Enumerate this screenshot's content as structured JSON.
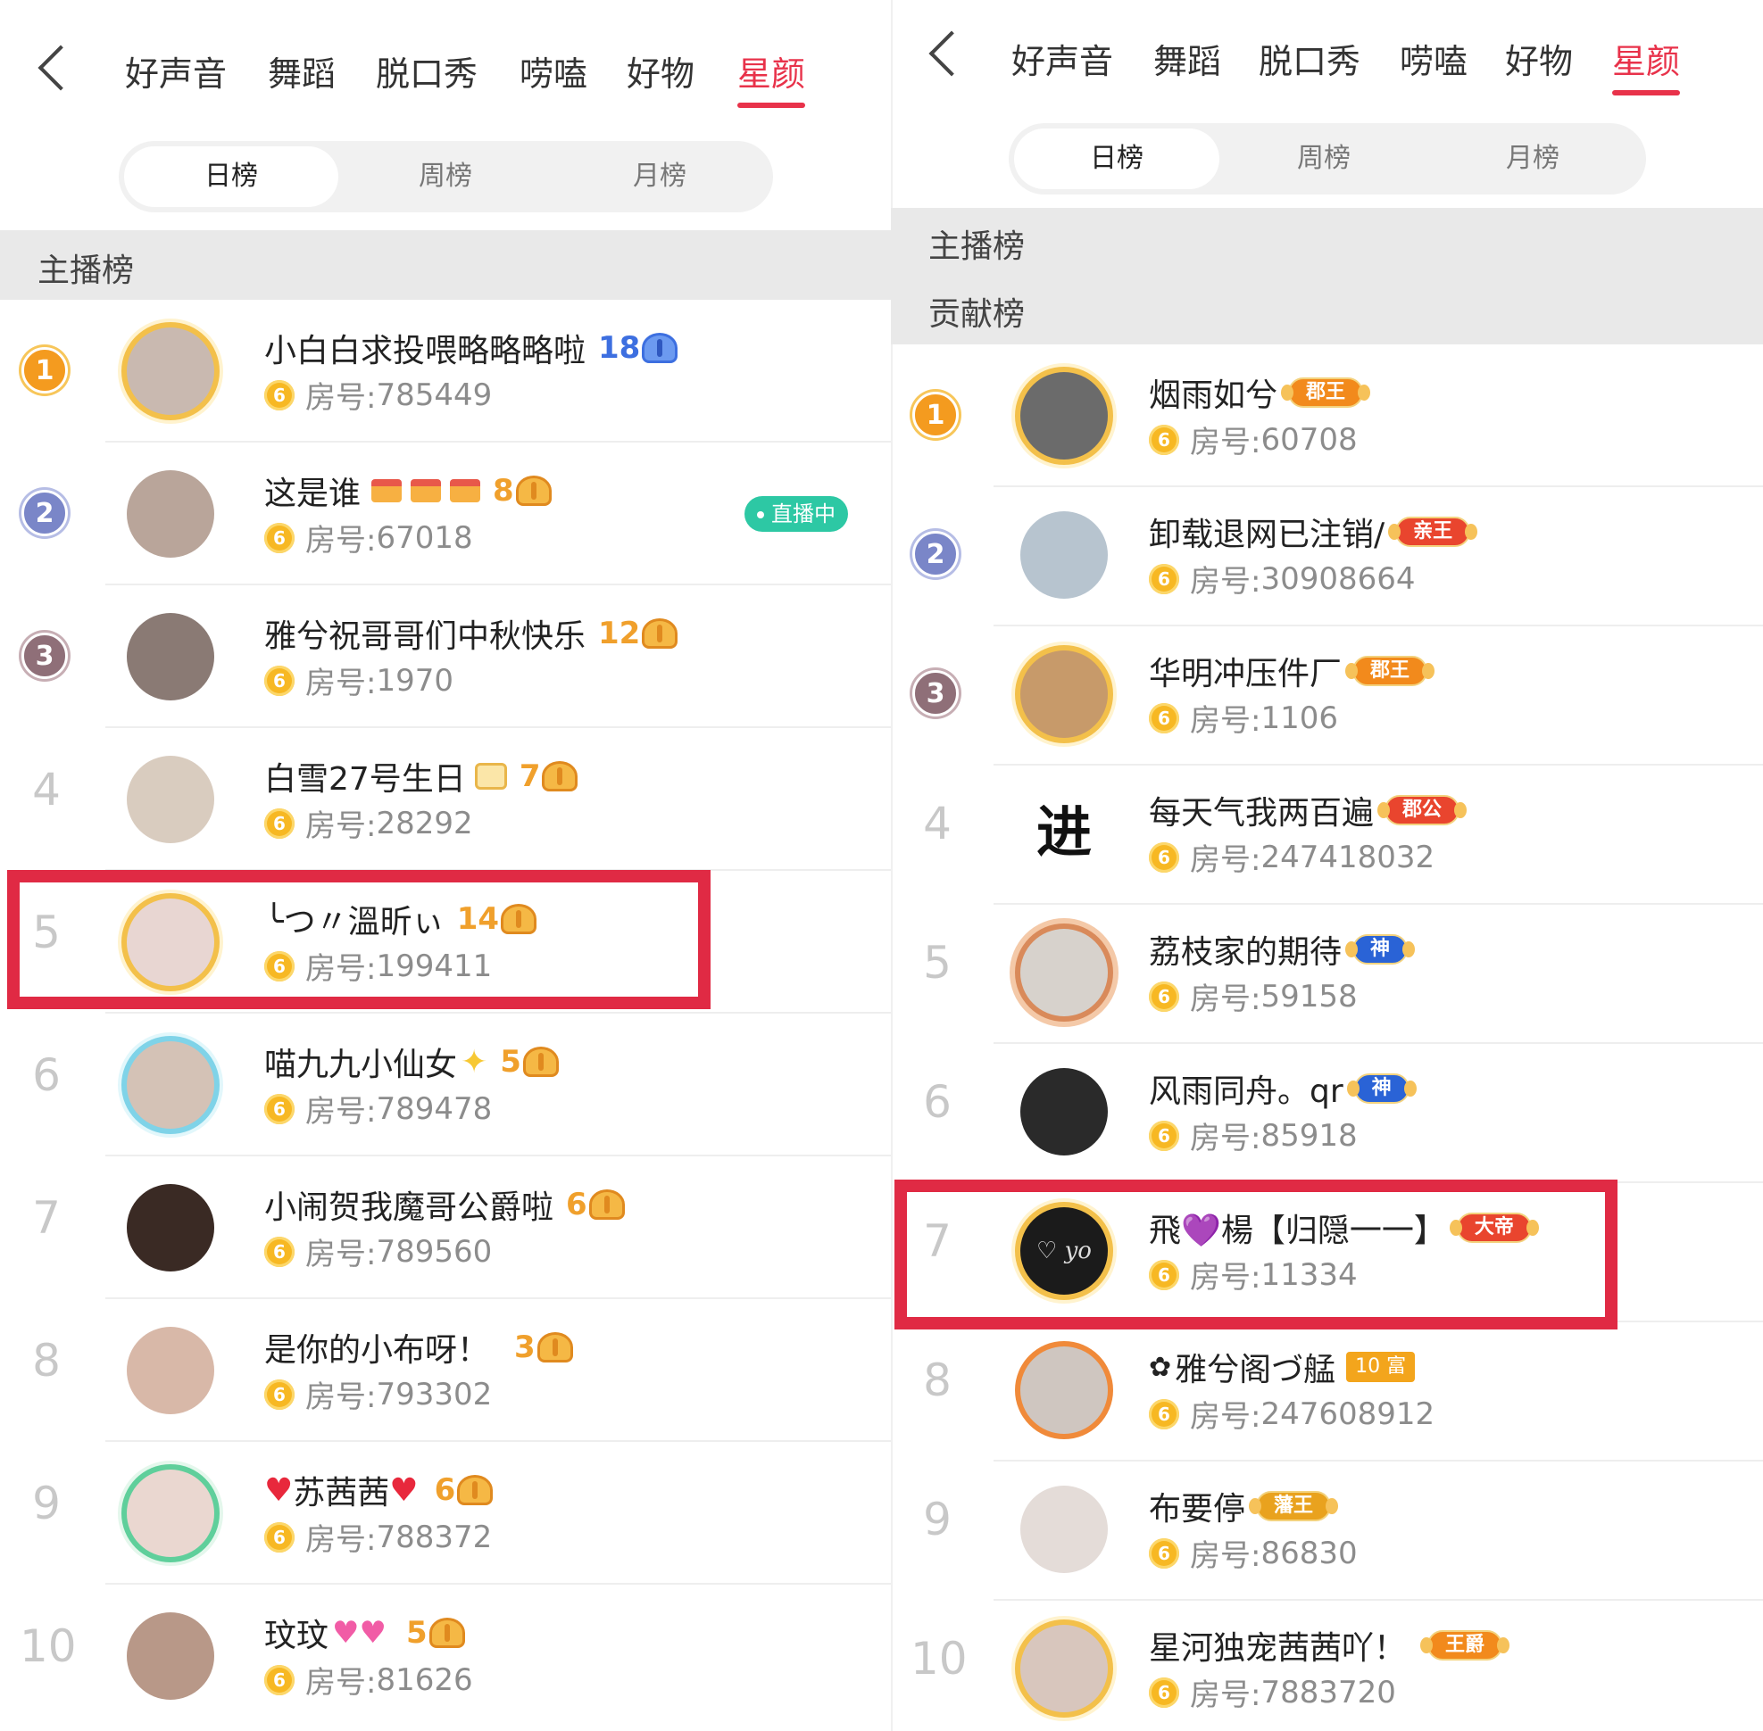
{
  "colors": {
    "accent": "#e8324a",
    "highlight": "#e02a44",
    "live": "#2dc8a4",
    "coin": "#f7b823"
  },
  "left": {
    "back_icon": "chevron-left-icon",
    "categories": [
      "好声音",
      "舞蹈",
      "脱口秀",
      "唠嗑",
      "好物",
      "星颜"
    ],
    "active_category": "星颜",
    "segments": [
      "日榜",
      "周榜",
      "月榜"
    ],
    "active_segment": "日榜",
    "section_label": "主播榜",
    "rows": [
      {
        "rank": "1",
        "name": "小白白求投喂略略略啦",
        "level": "18",
        "room_prefix": "房号:",
        "room": "785449"
      },
      {
        "rank": "2",
        "name": "这是谁",
        "level": "8",
        "room_prefix": "房号:",
        "room": "67018",
        "live_label": "直播中"
      },
      {
        "rank": "3",
        "name": "雅兮祝哥哥们中秋快乐",
        "level": "12",
        "room_prefix": "房号:",
        "room": "1970"
      },
      {
        "rank": "4",
        "name": "白雪27号生日",
        "level": "7",
        "room_prefix": "房号:",
        "room": "28292"
      },
      {
        "rank": "5",
        "name": "╰つ〃溫昕ぃ",
        "level": "14",
        "room_prefix": "房号:",
        "room": "199411"
      },
      {
        "rank": "6",
        "name": "喵九九小仙女",
        "level": "5",
        "room_prefix": "房号:",
        "room": "789478"
      },
      {
        "rank": "7",
        "name": "小闹贺我魔哥公爵啦",
        "level": "6",
        "room_prefix": "房号:",
        "room": "789560"
      },
      {
        "rank": "8",
        "name": "是你的小布呀！",
        "level": "3",
        "room_prefix": "房号:",
        "room": "793302"
      },
      {
        "rank": "9",
        "name": "苏茜茜",
        "level": "6",
        "room_prefix": "房号:",
        "room": "788372"
      },
      {
        "rank": "10",
        "name": "玟玟",
        "level": "5",
        "room_prefix": "房号:",
        "room": "81626"
      }
    ]
  },
  "right": {
    "back_icon": "chevron-left-icon",
    "categories": [
      "好声音",
      "舞蹈",
      "脱口秀",
      "唠嗑",
      "好物",
      "星颜"
    ],
    "active_category": "星颜",
    "segments": [
      "日榜",
      "周榜",
      "月榜"
    ],
    "active_segment": "日榜",
    "section_label_1": "主播榜",
    "section_label_2": "贡献榜",
    "rows": [
      {
        "rank": "1",
        "name": "烟雨如兮",
        "badge": "郡王",
        "room_prefix": "房号:",
        "room": "60708"
      },
      {
        "rank": "2",
        "name": "卸载退网已注销/",
        "badge": "亲王",
        "room_prefix": "房号:",
        "room": "30908664"
      },
      {
        "rank": "3",
        "name": "华明冲压件厂",
        "badge": "郡王",
        "room_prefix": "房号:",
        "room": "1106"
      },
      {
        "rank": "4",
        "name": "每天气我两百遍",
        "badge": "郡公",
        "room_prefix": "房号:",
        "room": "247418032",
        "avatar_char": "进"
      },
      {
        "rank": "5",
        "name": "荔枝家的期待",
        "badge": "神",
        "room_prefix": "房号:",
        "room": "59158"
      },
      {
        "rank": "6",
        "name": "风雨同舟。qr",
        "badge": "神",
        "room_prefix": "房号:",
        "room": "85918"
      },
      {
        "rank": "7",
        "name": "飛💜楊【归隠一一】",
        "badge": "大帝",
        "room_prefix": "房号:",
        "room": "11334",
        "avatar_text": "♡ yo"
      },
      {
        "rank": "8",
        "name": "雅兮阁づ艋",
        "badge_num": "10",
        "badge": "富",
        "room_prefix": "房号:",
        "room": "247608912"
      },
      {
        "rank": "9",
        "name": "布要停",
        "badge": "藩王",
        "room_prefix": "房号:",
        "room": "86830"
      },
      {
        "rank": "10",
        "name": "星河独宠茜茜吖！",
        "badge": "王爵",
        "room_prefix": "房号:",
        "room": "7883720"
      }
    ]
  },
  "coin_glyph": "6"
}
